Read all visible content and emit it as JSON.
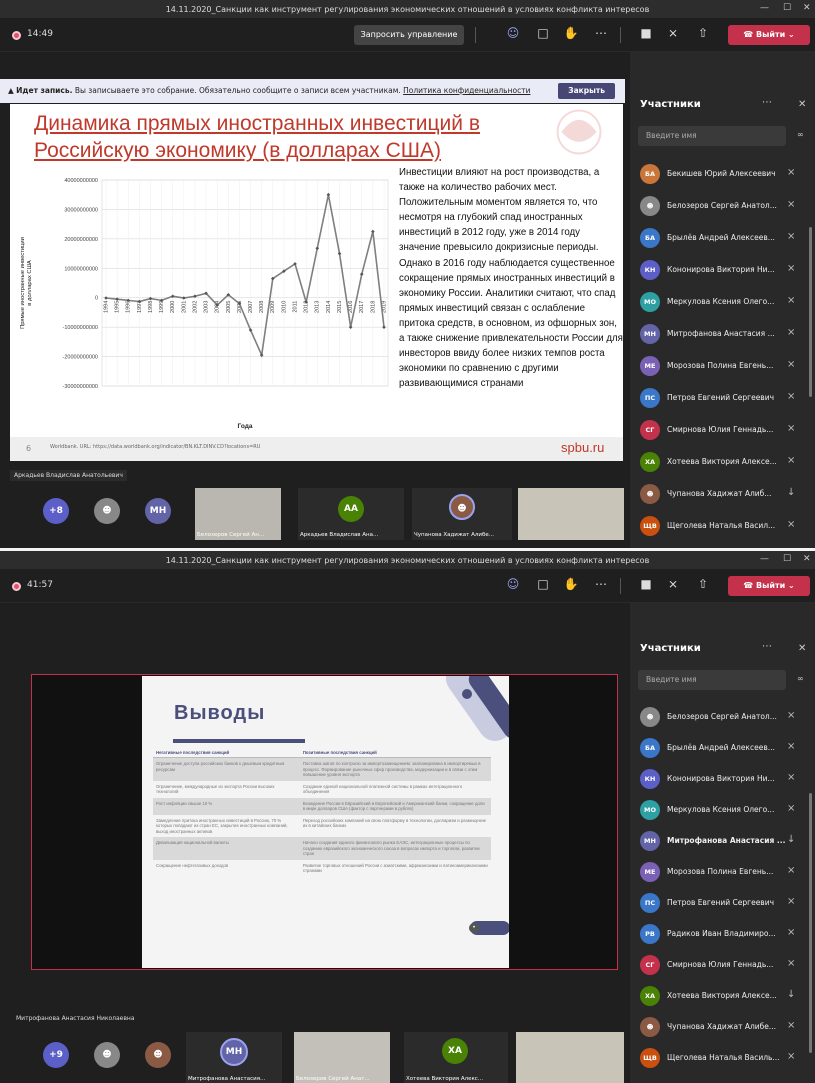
{
  "window_title": "14.11.2020_Санкции как инструмент регулирования экономических отношений в условиях конфликта интересов",
  "window_controls": {
    "minimize": "—",
    "maximize": "☐",
    "close": "✕"
  },
  "shot1": {
    "timer": "14:49",
    "request_control": "Запросить управление",
    "leave": "Выйти",
    "banner": {
      "bold": "Идет запись.",
      "text": "Вы записываете это собрание. Обязательно сообщите о записи всем участникам.",
      "link": "Политика конфиденциальности",
      "close": "Закрыть"
    },
    "slide": {
      "title_line1": "Динамика прямых иностранных инвестиций в",
      "title_line2": "Российскую экономику (в долларах США)",
      "text": "Инвестиции влияют на рост производства, а также на количество рабочих мест. Положительным моментом является то, что несмотря на глубокий спад иностранных инвестиций в 2012 году, уже в 2014 году значение превысило докризисные периоды. Однако в 2016 году наблюдается существенное сокращение прямых иностранных инвестиций в экономику России.  Аналитики считают, что спад прямых инвестиций связан с ослабление притока средств, в основном, из офшорных зон, а также снижение привлекательности России для инвесторов ввиду более низких темпов роста экономики по сравнению с другими развивающимися странами",
      "page_number": "6",
      "source": "Worldbank. URL: https://data.worldbank.org/indicator/BN.KLT.DINV.CD?locations=RU",
      "logo": "spbu.ru"
    },
    "presenter_label": "Аркадьев Владислав Анатольевич",
    "bottom": {
      "more_count": "+8",
      "mn_initials": "МН",
      "vid1_name": "Белозеров Сергей Ан...",
      "aa_initials": "АА",
      "aa_name": "Аркадьев Владислав Ана...",
      "vid2_name": "Чупанова Хадижат Алибе..."
    },
    "panel": {
      "title": "Участники",
      "search_placeholder": "Введите имя",
      "participants": [
        {
          "initials": "БА",
          "name": "Бекишев Юрий Алексеевич",
          "color": "#c9763b",
          "mic": "muted"
        },
        {
          "initials": "",
          "name": "Белозеров Сергей Анатол...",
          "color": "#888888",
          "mic": "muted"
        },
        {
          "initials": "БА",
          "name": "Брылёв Андрей Алексеев...",
          "color": "#3a77c9",
          "mic": "muted"
        },
        {
          "initials": "КН",
          "name": "Кононирова Виктория Ни...",
          "color": "#5b5fc7",
          "mic": "muted"
        },
        {
          "initials": "МО",
          "name": "Меркулова Ксения Олего...",
          "color": "#2e9fa3",
          "mic": "muted"
        },
        {
          "initials": "МН",
          "name": "Митрофанова Анастасия ...",
          "color": "#6264a7",
          "mic": "muted"
        },
        {
          "initials": "МЕ",
          "name": "Морозова Полина Евгень...",
          "color": "#7b61b5",
          "mic": "muted"
        },
        {
          "initials": "ПС",
          "name": "Петров Евгений Сергеевич",
          "color": "#3a77c9",
          "mic": "muted"
        },
        {
          "initials": "СГ",
          "name": "Смирнова Юлия Геннадь...",
          "color": "#c4314b",
          "mic": "muted"
        },
        {
          "initials": "ХА",
          "name": "Хотеева Виктория Алексе...",
          "color": "#498205",
          "mic": "muted"
        },
        {
          "initials": "",
          "name": "Чупанова Хадижат Алиб...",
          "color": "#8a5a44",
          "mic": "on"
        },
        {
          "initials": "ЩВ",
          "name": "Щеголева Наталья Васил...",
          "color": "#ca5010",
          "mic": "muted"
        }
      ]
    }
  },
  "shot2": {
    "timer": "41:57",
    "leave": "Выйти",
    "slide": {
      "title": "Выводы",
      "col_neg": "Негативные последствия санкций",
      "col_pos": "Позитивные последствия санкций",
      "rows": [
        [
          "Ограничение доступа российских банков к дешевым кредитным ресурсам",
          "Поставка шагов по контролю за импортозамещением: запланирована в импортиремых в процесс. Формирование рыночных сфер производства, модернизации и в связи с этим повышение уровня экспорта"
        ],
        [
          "Ограничение, международные из экспорта России высоких технологий",
          "Создание единой национальной платежной системы в рамках интеграционного объединения"
        ],
        [
          "Рост инфляции свыше 10 %",
          "Вхождение России в Евразийский и Европейский и Американский банки, сокращение доли в мире долларов США (фактор с партнерами в рублях)"
        ],
        [
          "Замедление притока иностранных инвестиций в Россию, 70 % которых попадают из стран ЕС, закрытие иностранных компаний, выход иностранных активов",
          "Переход российских компаний на свою платформу в технологии, долларизм и размещение их в китайских банках"
        ],
        [
          "Девальвация национальной валюты",
          "Начало создания единого финансового рынка ЕАЭС, интеграционные процессы по созданию евразийского экономического союза в вопросах импорта и торговли, развитие стран"
        ],
        [
          "Сокращение нефтегазовых доходов",
          "Развитие торговых отношений России с азиатскими, африканскими и латиноамериканскими странами"
        ]
      ]
    },
    "speaker_label": "Митрофанова Анастасия Николаевна",
    "bottom": {
      "more_count": "+9",
      "mn_initials": "МН",
      "mn_name": "Митрофанова Анастасия...",
      "vid_name": "Белозеров Сергей Анат...",
      "xa_initials": "ХА",
      "xa_name": "Хотеева Виктория Алекс..."
    },
    "panel": {
      "title": "Участники",
      "search_placeholder": "Введите имя",
      "participants": [
        {
          "initials": "",
          "name": "Белозеров Сергей Анатол...",
          "color": "#888888",
          "mic": "muted",
          "bold": false
        },
        {
          "initials": "БА",
          "name": "Брылёв Андрей Алексеев...",
          "color": "#3a77c9",
          "mic": "muted",
          "bold": false
        },
        {
          "initials": "КН",
          "name": "Кононирова Виктория Ни...",
          "color": "#5b5fc7",
          "mic": "muted",
          "bold": false
        },
        {
          "initials": "МО",
          "name": "Меркулова Ксения Олего...",
          "color": "#2e9fa3",
          "mic": "muted",
          "bold": false
        },
        {
          "initials": "МН",
          "name": "Митрофанова Анастасия ...",
          "color": "#6264a7",
          "mic": "on",
          "bold": true
        },
        {
          "initials": "МЕ",
          "name": "Морозова Полина Евгень...",
          "color": "#7b61b5",
          "mic": "muted",
          "bold": false
        },
        {
          "initials": "ПС",
          "name": "Петров Евгений Сергеевич",
          "color": "#3a77c9",
          "mic": "muted",
          "bold": false
        },
        {
          "initials": "РВ",
          "name": "Радиков Иван Владимиро...",
          "color": "#3a77c9",
          "mic": "muted",
          "bold": false
        },
        {
          "initials": "СГ",
          "name": "Смирнова Юлия Геннадь...",
          "color": "#c4314b",
          "mic": "muted",
          "bold": false
        },
        {
          "initials": "ХА",
          "name": "Хотеева Виктория Алексе...",
          "color": "#498205",
          "mic": "on",
          "bold": false
        },
        {
          "initials": "",
          "name": "Чупанова Хадижат Алибе...",
          "color": "#8a5a44",
          "mic": "muted",
          "bold": false
        },
        {
          "initials": "ЩВ",
          "name": "Щеголева Наталья Василь...",
          "color": "#ca5010",
          "mic": "muted",
          "bold": false
        }
      ]
    }
  },
  "chart_data": {
    "type": "line",
    "xlabel": "Года",
    "ylabel": "Прямые иностранные инвестиции в долларах США",
    "ylim": [
      -30000000000,
      40000000000
    ],
    "yticks": [
      "40000000000",
      "30000000000",
      "20000000000",
      "10000000000",
      "0",
      "-10000000000",
      "-20000000000",
      "-30000000000"
    ],
    "categories": [
      "1994",
      "1995",
      "1996",
      "1997",
      "1998",
      "1999",
      "2000",
      "2001",
      "2002",
      "2003",
      "2004",
      "2005",
      "2006",
      "2007",
      "2008",
      "2009",
      "2010",
      "2011",
      "2012",
      "2013",
      "2014",
      "2015",
      "2016",
      "2017",
      "2018",
      "2019"
    ],
    "series": [
      {
        "values": [
          -100000000.0,
          -500000000.0,
          -900000000.0,
          -1300000000.0,
          -300000000.0,
          -900000000.0,
          500000000.0,
          -100000000.0,
          500000000.0,
          1500000000.0,
          -2500000000.0,
          1000000000.0,
          -2000000000.0,
          -11000000000.0,
          -19500000000.0,
          6500000000.0,
          9000000000.0,
          11500000000.0,
          -1500000000.0,
          16800000000.0,
          35000000000.0,
          15000000000.0,
          -10000000000.0,
          8000000000.0,
          22500000000.0,
          -10000000000.0
        ]
      }
    ],
    "grid": true,
    "colors": {
      "line": "#7f7f7f",
      "marker": "#555555"
    }
  }
}
